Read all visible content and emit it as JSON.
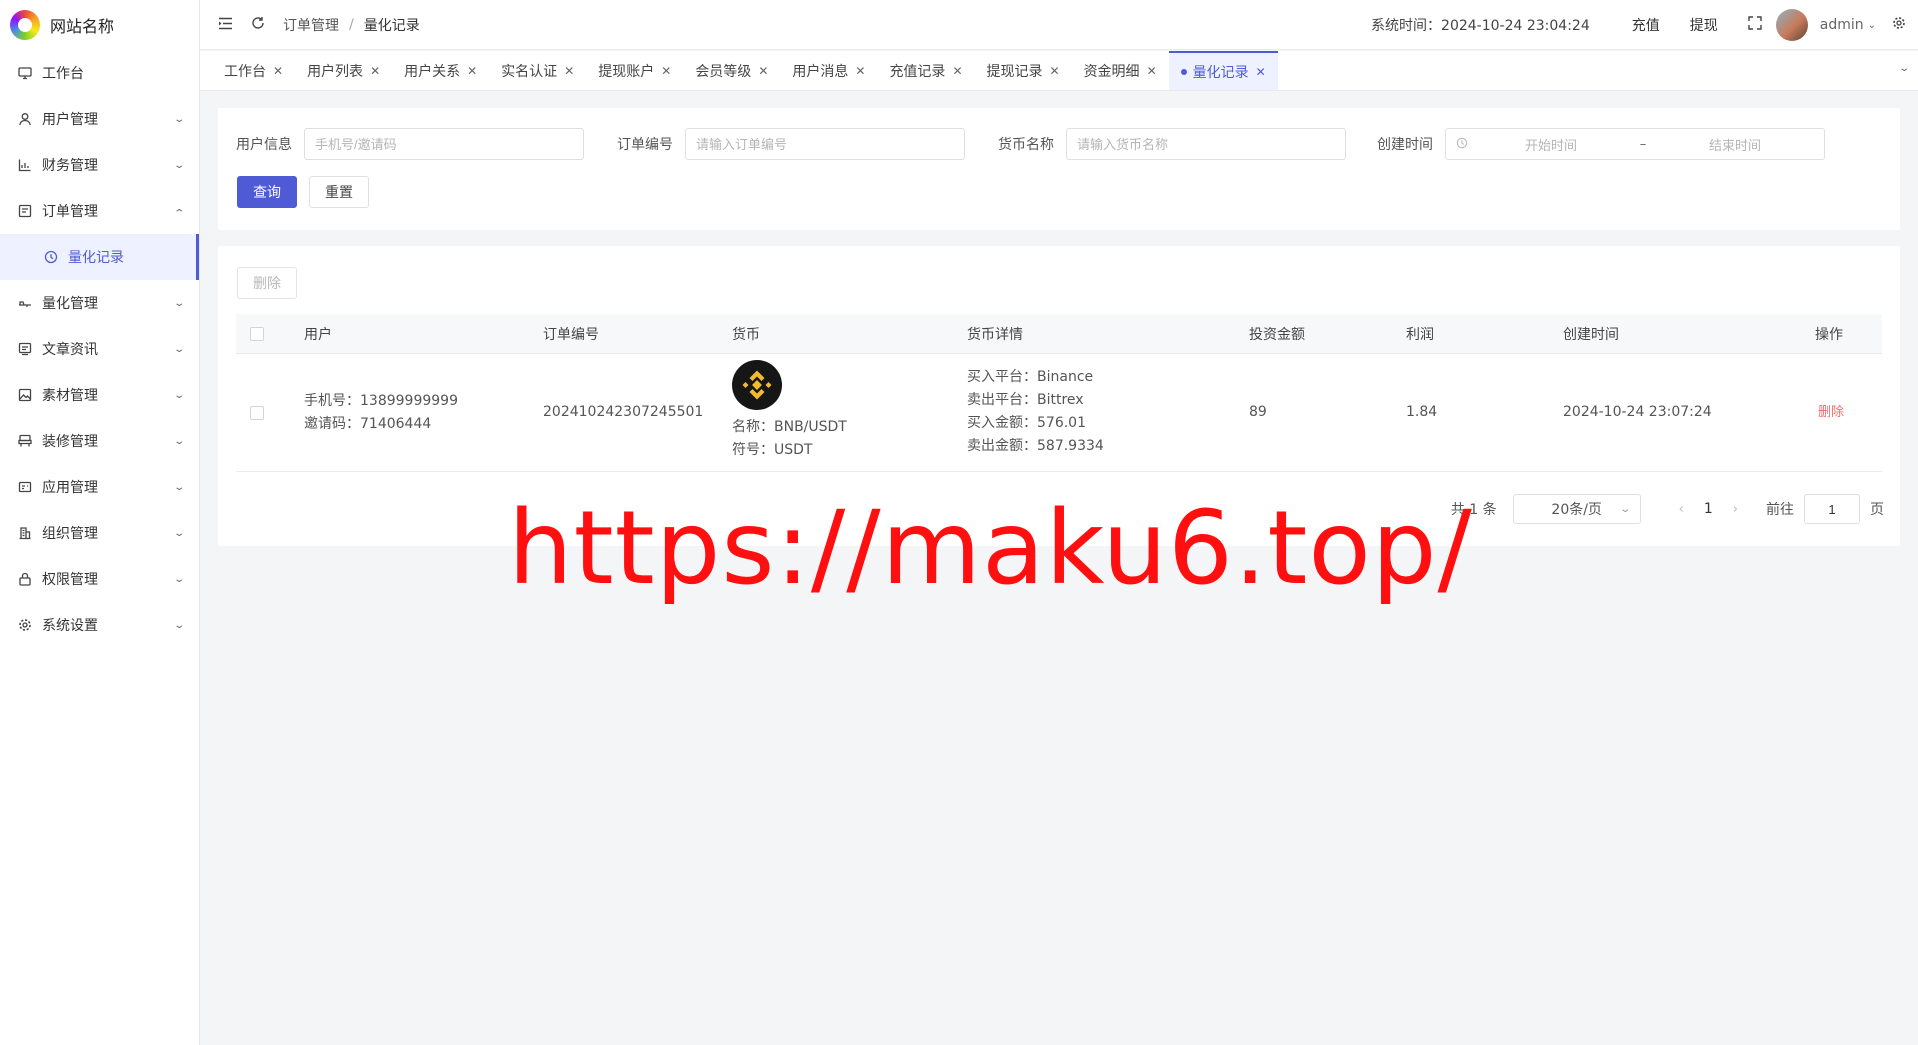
{
  "brand": {
    "name": "网站名称"
  },
  "sidebar": {
    "items": [
      {
        "label": "工作台",
        "icon": "monitor-icon"
      },
      {
        "label": "用户管理",
        "icon": "user-icon"
      },
      {
        "label": "财务管理",
        "icon": "chart-icon"
      },
      {
        "label": "订单管理",
        "icon": "order-icon"
      },
      {
        "label": "量化记录",
        "icon": "clock-icon"
      },
      {
        "label": "量化管理",
        "icon": "robot-icon"
      },
      {
        "label": "文章资讯",
        "icon": "article-icon"
      },
      {
        "label": "素材管理",
        "icon": "image-icon"
      },
      {
        "label": "装修管理",
        "icon": "decor-icon"
      },
      {
        "label": "应用管理",
        "icon": "app-icon"
      },
      {
        "label": "组织管理",
        "icon": "org-icon"
      },
      {
        "label": "权限管理",
        "icon": "lock-icon"
      },
      {
        "label": "系统设置",
        "icon": "gear-icon"
      }
    ]
  },
  "header": {
    "breadcrumb": [
      "订单管理",
      "量化记录"
    ],
    "system_time_label": "系统时间：",
    "system_time": "2024-10-24 23:04:24",
    "recharge": "充值",
    "withdraw": "提现",
    "user": "admin"
  },
  "tabs": [
    "工作台",
    "用户列表",
    "用户关系",
    "实名认证",
    "提现账户",
    "会员等级",
    "用户消息",
    "充值记录",
    "提现记录",
    "资金明细",
    "量化记录"
  ],
  "search": {
    "user_label": "用户信息",
    "user_placeholder": "手机号/邀请码",
    "order_label": "订单编号",
    "order_placeholder": "请输入订单编号",
    "coin_label": "货币名称",
    "coin_placeholder": "请输入货币名称",
    "time_label": "创建时间",
    "start_placeholder": "开始时间",
    "range_sep": "–",
    "end_placeholder": "结束时间",
    "query": "查询",
    "reset": "重置"
  },
  "table": {
    "delete_button": "删除",
    "columns": [
      "用户",
      "订单编号",
      "货币",
      "货币详情",
      "投资金额",
      "利润",
      "创建时间",
      "操作"
    ],
    "rows": [
      {
        "phone": "手机号：13899999999",
        "invite": "邀请码：71406444",
        "order_no": "202410242307245501",
        "coin_name": "名称：BNB/USDT",
        "coin_symbol": "符号：USDT",
        "buy_platform": "买入平台：Binance",
        "sell_platform": "卖出平台：Bittrex",
        "buy_amount": "买入金额：576.01",
        "sell_amount": "卖出金额：587.9334",
        "invest": "89",
        "profit": "1.84",
        "created": "2024-10-24 23:07:24",
        "action": "删除"
      }
    ]
  },
  "pagination": {
    "total": "共 1 条",
    "page_size": "20条/页",
    "current": "1",
    "goto": "前往",
    "jump_value": "1",
    "page_unit": "页"
  },
  "watermark": "https://maku6.top/",
  "colors": {
    "primary": "#4f5bd5",
    "danger": "#f56c6c",
    "watermark": "#ff0f0f",
    "binance": "#f3ba2f"
  }
}
